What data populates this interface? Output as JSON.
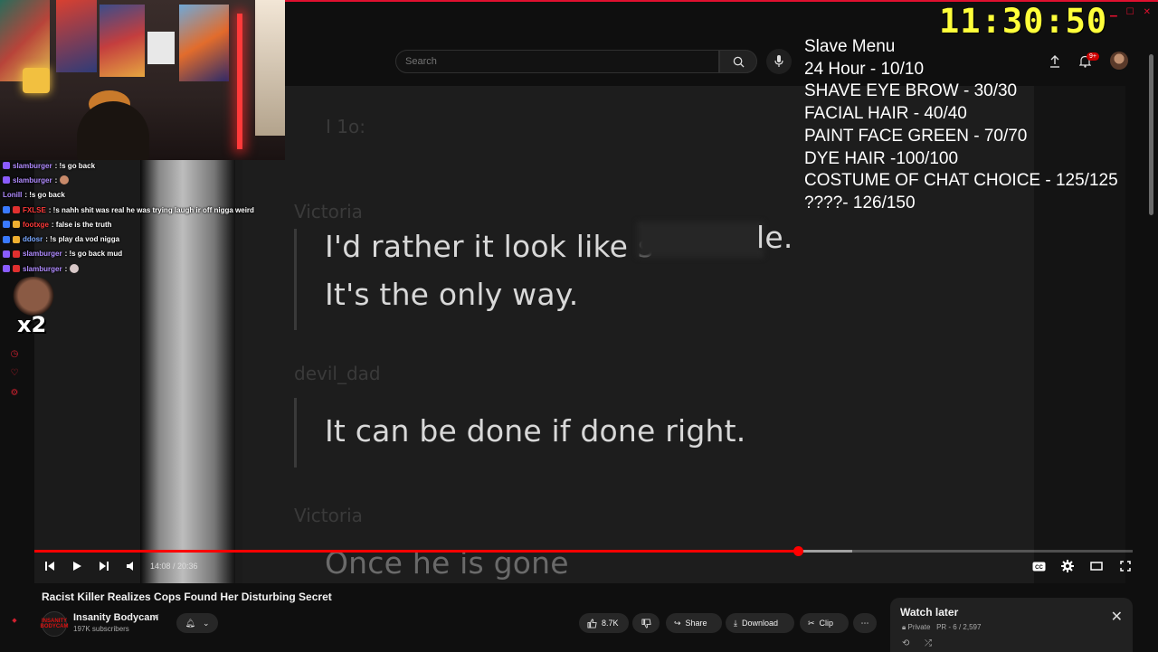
{
  "search": {
    "placeholder": "Search"
  },
  "header": {
    "notification_count": "9+"
  },
  "video": {
    "overlay_lines": {
      "line1": "I'd rather it look like s",
      "line1_end": "le.",
      "line2": "It's the only way.",
      "line3": "It can be done if done right.",
      "line4": "Once he is gone"
    },
    "faint_labels": [
      "Victoria",
      "devil_dad",
      "Victoria"
    ],
    "faint_top": "I 1o:",
    "time": "14:08 / 20:36",
    "progress_fraction": 0.695,
    "buffer_fraction": 0.745
  },
  "title": "Racist Killer Realizes Cops Found Her Disturbing Secret",
  "channel": {
    "name": "Insanity Bodycam",
    "subscribers": "197K subscribers",
    "avatar_text": "INSANITY BODYCAM"
  },
  "actions": {
    "likes": "8.7K",
    "share": "Share",
    "download": "Download",
    "clip": "Clip"
  },
  "watch_later": {
    "title": "Watch later",
    "privacy": "Private",
    "position": "PR - 6 / 2,597"
  },
  "stream": {
    "clock": "11:30:50",
    "menu_title": "Slave Menu",
    "menu_items": [
      "24 Hour - 10/10",
      "SHAVE EYE BROW - 30/30",
      "FACIAL HAIR - 40/40",
      "PAINT FACE GREEN - 70/70",
      "DYE HAIR -100/100",
      "COSTUME OF CHAT CHOICE - 125/125",
      "????- 126/150"
    ],
    "emote_multiplier": "x2"
  },
  "chat": [
    {
      "user": "slamburger",
      "message": ": !s go back",
      "color": "#b18cff"
    },
    {
      "user": "slamburger",
      "message": ":",
      "color": "#b18cff"
    },
    {
      "user": "LoniII",
      "message": ": !s go back",
      "color": "#b18cff"
    },
    {
      "user": "FXLSE",
      "message": ": !s nahh shit was real he was trying laugh ir off nigga weird",
      "color": "#ff3a3a"
    },
    {
      "user": "footxge",
      "message": ": false is the truth",
      "color": "#ff3a3a"
    },
    {
      "user": "ddosr",
      "message": ": !s play da vod nigga",
      "color": "#7aa8ff"
    },
    {
      "user": "slamburger",
      "message": ": !s go back mud",
      "color": "#b18cff"
    },
    {
      "user": "slamburger",
      "message": ":",
      "color": "#b18cff"
    }
  ]
}
